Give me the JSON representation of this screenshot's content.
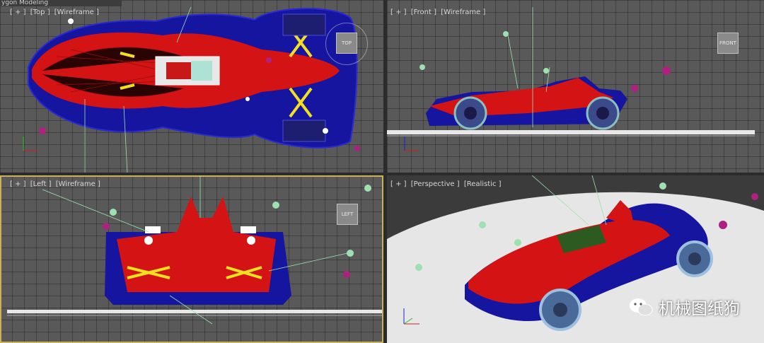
{
  "app": {
    "title_fragment": "ygon Modeling"
  },
  "viewports": {
    "top": {
      "plus": "[ + ]",
      "view": "[Top ]",
      "mode": "[Wireframe ]",
      "cube_label": "TOP"
    },
    "front": {
      "plus": "[ + ]",
      "view": "[Front ]",
      "mode": "[Wireframe ]",
      "cube_label": "FRONT"
    },
    "left": {
      "plus": "[ + ]",
      "view": "[Left ]",
      "mode": "[Wireframe ]",
      "cube_label": "LEFT"
    },
    "perspective": {
      "plus": "[ + ]",
      "view": "[Perspective ]",
      "mode": "[Realistic ]"
    }
  },
  "watermark": {
    "text": "机械图纸狗"
  },
  "colors": {
    "body_red": "#d41414",
    "body_blue": "#1515a0",
    "grid_bg": "#595959",
    "active_border": "#c8b25a",
    "yellow": "#f0e020",
    "light_green": "#9ee0b0",
    "magenta": "#b02080",
    "ground_white": "#e8e8e8"
  },
  "icons": [
    "axis-tripod-icon",
    "viewcube-icon",
    "wechat-logo-icon",
    "light-helper-icon"
  ]
}
